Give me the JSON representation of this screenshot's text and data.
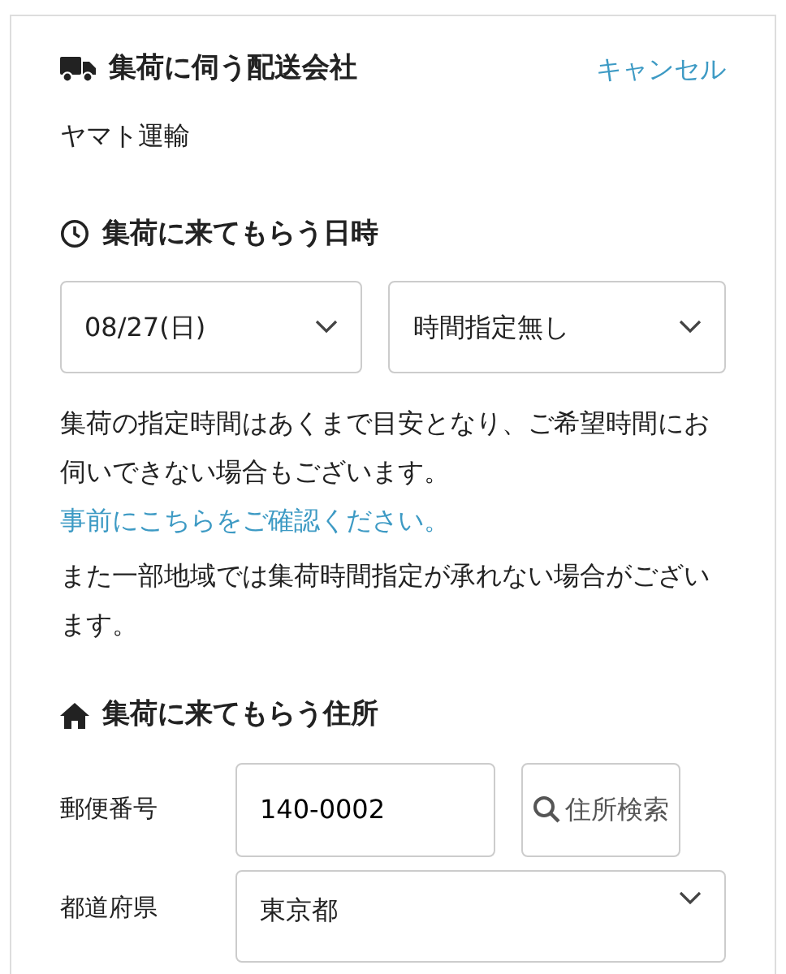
{
  "carrier": {
    "title": "集荷に伺う配送会社",
    "cancel": "キャンセル",
    "name": "ヤマト運輸"
  },
  "datetime": {
    "title": "集荷に来てもらう日時",
    "date": "08/27(日)",
    "time": "時間指定無し",
    "note": "集荷の指定時間はあくまで目安となり、ご希望時間にお伺いできない場合もございます。",
    "link": "事前にこちらをご確認ください。",
    "note2": "また一部地域では集荷時間指定が承れない場合がございます。"
  },
  "address": {
    "title": "集荷に来てもらう住所",
    "postal_label": "郵便番号",
    "postal": "140-0002",
    "search_button": "住所検索",
    "pref_label": "都道府県",
    "pref": "東京都"
  }
}
